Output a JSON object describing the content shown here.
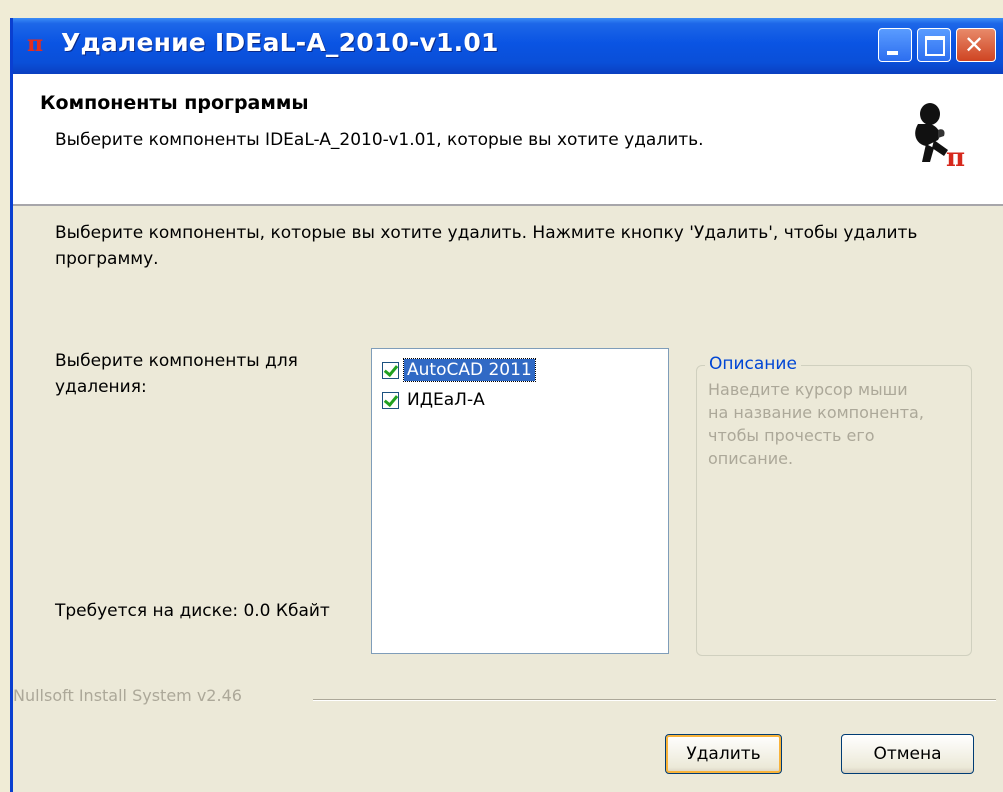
{
  "window": {
    "title": "Удаление IDEaL-A_2010-v1.01",
    "title_icon": "π"
  },
  "header": {
    "title": "Компоненты программы",
    "subtitle": "Выберите компоненты IDEaL-A_2010-v1.01, которые вы хотите удалить."
  },
  "body": {
    "intro": "Выберите компоненты, которые вы хотите удалить. Нажмите кнопку 'Удалить', чтобы удалить программу.",
    "choose_label": "Выберите компоненты для удаления:",
    "disk_label": "Требуется на диске: 0.0 Кбайт"
  },
  "components": [
    {
      "label": "AutoCAD 2011",
      "checked": true,
      "selected": true
    },
    {
      "label": "ИДЕаЛ-А",
      "checked": true,
      "selected": false
    }
  ],
  "description": {
    "legend": "Описание",
    "text": "Наведите курсор мыши на название компонента, чтобы прочесть его описание."
  },
  "footer": {
    "brand": "Nullsoft Install System v2.46",
    "remove_label": "Удалить",
    "cancel_label": "Отмена"
  },
  "colors": {
    "title_bar": "#0a54e3",
    "selection": "#316ac5",
    "legend": "#0046d5",
    "disabled_text": "#aca899"
  },
  "icons": [
    "pi-app-icon",
    "minimize-icon",
    "maximize-icon",
    "close-icon",
    "thinker-logo-icon",
    "checkbox-checked-icon"
  ]
}
